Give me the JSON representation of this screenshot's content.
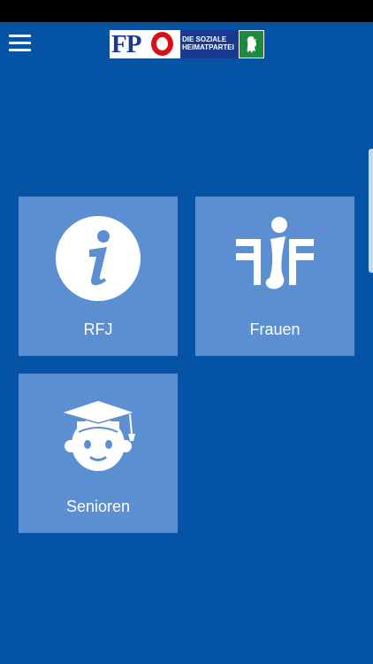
{
  "header": {
    "menu_icon": "hamburger-menu-icon",
    "logo": {
      "letters": "FP",
      "tagline_line1": "DIE SOZIALE",
      "tagline_line2": "HEIMATPARTEI"
    }
  },
  "colors": {
    "background": "#0553a4",
    "tile": "#5b8fd1",
    "status_bar": "#000000",
    "logo_blue": "#1b3a8f",
    "logo_red": "#d9101a",
    "logo_green": "#1d8a3c"
  },
  "tiles": [
    {
      "label": "RFJ",
      "icon": "info-icon"
    },
    {
      "label": "Frauen",
      "icon": "frauen-logo-icon"
    },
    {
      "label": "Senioren",
      "icon": "graduate-icon"
    }
  ]
}
